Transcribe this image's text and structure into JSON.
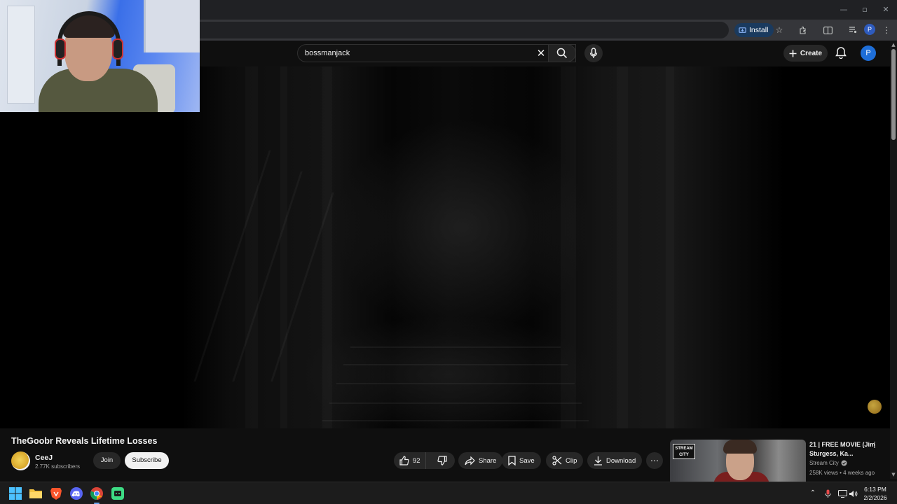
{
  "browser": {
    "install_label": "Install",
    "profile_initial": "P"
  },
  "masthead": {
    "search_query": "bossmanjack",
    "create_label": "Create",
    "avatar_initial": "P"
  },
  "video": {
    "title": "TheGoobr Reveals Lifetime Losses",
    "channel_name": "CeeJ",
    "subscribers": "2.77K subscribers",
    "join_label": "Join",
    "subscribe_label": "Subscribe",
    "like_count": "92",
    "share_label": "Share",
    "save_label": "Save",
    "clip_label": "Clip",
    "download_label": "Download"
  },
  "recommendation": {
    "title": "21 | FREE MOVIE (Jim Sturgess, Ka...",
    "channel": "Stream City",
    "meta": "258K views • 4 weeks ago",
    "thumb_logo": "STREAM CITY"
  },
  "taskbar": {
    "time": "6:13 PM",
    "date": "2/2/2026"
  },
  "colors": {
    "background": "#0f0f0f",
    "chip": "#272727",
    "subscribe_bg": "#f1f1f1",
    "accent_blue": "#1e6ed8",
    "install_chip": "#1a3a5e"
  },
  "icons": [
    "minimize-icon",
    "maximize-icon",
    "close-window-icon",
    "install-icon",
    "star-icon",
    "extensions-icon",
    "split-view-icon",
    "media-controls-icon",
    "kebab-menu-icon",
    "clear-icon",
    "search-icon",
    "mic-icon",
    "plus-icon",
    "bell-icon",
    "thumbs-up-icon",
    "thumbs-down-icon",
    "share-icon",
    "bookmark-icon",
    "scissors-icon",
    "download-icon",
    "more-icon",
    "verified-icon",
    "windows-start-icon",
    "file-explorer-icon",
    "brave-icon",
    "discord-icon",
    "chrome-icon",
    "app-icon",
    "chevron-up-icon",
    "microphone-tray-icon",
    "network-icon",
    "volume-icon"
  ]
}
